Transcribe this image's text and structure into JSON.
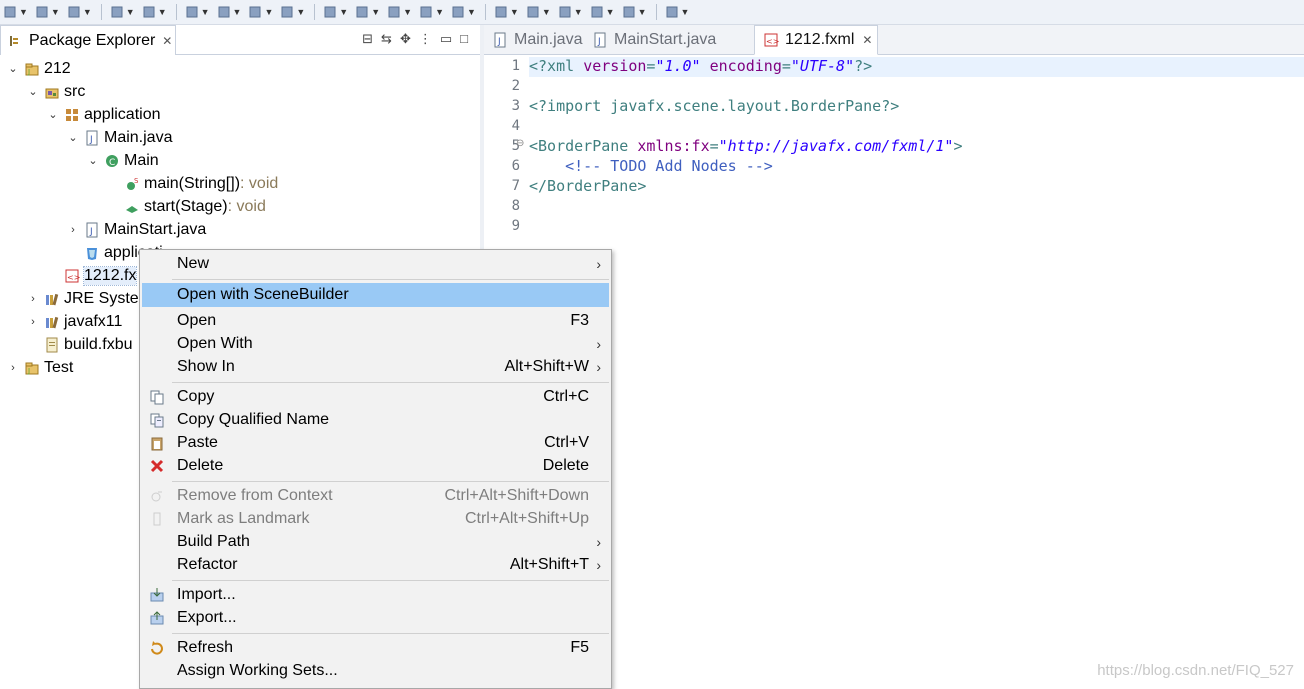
{
  "toolbar": {
    "icons": [
      "new-icon",
      "save-icon",
      "save-all-icon",
      "terminal-icon",
      "search-icon",
      "debug-icon",
      "run-icon",
      "run-extern-icon",
      "coverage-icon",
      "new-java-project-icon",
      "new-package-icon",
      "new-class-icon",
      "open-type-icon",
      "open-task-icon",
      "search-icon-2",
      "annotation-next-icon",
      "annotation-prev-icon",
      "back-icon",
      "forward-icon",
      "pin-editor-icon"
    ]
  },
  "explorer": {
    "tab_label": "Package Explorer",
    "tree": [
      {
        "label": "212",
        "depth": 0,
        "twisty": "open",
        "icon": "project-icon"
      },
      {
        "label": "src",
        "depth": 1,
        "twisty": "open",
        "icon": "source-folder-icon"
      },
      {
        "label": "application",
        "depth": 2,
        "twisty": "open",
        "icon": "package-icon"
      },
      {
        "label": "Main.java",
        "depth": 3,
        "twisty": "open",
        "icon": "java-file-icon"
      },
      {
        "label": "Main",
        "depth": 4,
        "twisty": "open",
        "icon": "class-icon"
      },
      {
        "label": "main(String[])",
        "suffix": " : void",
        "depth": 5,
        "twisty": "none",
        "icon": "static-method-icon"
      },
      {
        "label": "start(Stage)",
        "suffix": " : void",
        "depth": 5,
        "twisty": "none",
        "icon": "method-icon"
      },
      {
        "label": "MainStart.java",
        "depth": 3,
        "twisty": "closed",
        "icon": "java-file-icon"
      },
      {
        "label": "applicati",
        "depth": 3,
        "twisty": "none",
        "icon": "css-file-icon"
      },
      {
        "label": "1212.fx",
        "depth": 2,
        "twisty": "none",
        "icon": "fxml-file-icon",
        "selected": true
      },
      {
        "label": "JRE Syster",
        "depth": 1,
        "twisty": "closed",
        "icon": "library-icon"
      },
      {
        "label": "javafx11",
        "depth": 1,
        "twisty": "closed",
        "icon": "library-icon"
      },
      {
        "label": "build.fxbu",
        "depth": 1,
        "twisty": "none",
        "icon": "build-file-icon"
      },
      {
        "label": "Test",
        "depth": 0,
        "twisty": "closed",
        "icon": "project-icon"
      }
    ]
  },
  "editor": {
    "tabs": [
      {
        "label": "Main.java",
        "active": false
      },
      {
        "label": "MainStart.java",
        "active": false
      },
      {
        "label": "1212.fxml",
        "active": true
      }
    ],
    "lines": [
      {
        "n": "1",
        "segs": [
          [
            "tag",
            "<?xml "
          ],
          [
            "att",
            "version"
          ],
          [
            "tag",
            "="
          ],
          [
            "val",
            "\"1.0\""
          ],
          [
            "tag",
            " "
          ],
          [
            "att",
            "encoding"
          ],
          [
            "tag",
            "="
          ],
          [
            "val",
            "\"UTF-8\""
          ],
          [
            "tag",
            "?>"
          ]
        ]
      },
      {
        "n": "2",
        "segs": []
      },
      {
        "n": "3",
        "segs": [
          [
            "tag",
            "<?import javafx.scene.layout.BorderPane?>"
          ]
        ]
      },
      {
        "n": "4",
        "segs": []
      },
      {
        "n": "5",
        "segs": [
          [
            "tag",
            "<BorderPane "
          ],
          [
            "att",
            "xmlns:fx"
          ],
          [
            "tag",
            "="
          ],
          [
            "val",
            "\"http://javafx.com/fxml/1\""
          ],
          [
            "tag",
            ">"
          ]
        ]
      },
      {
        "n": "6",
        "segs": [
          [
            "com",
            "    <!-- TODO Add Nodes -->"
          ]
        ]
      },
      {
        "n": "7",
        "segs": [
          [
            "tag",
            "</BorderPane>"
          ]
        ]
      },
      {
        "n": "8",
        "segs": []
      },
      {
        "n": "9",
        "segs": []
      }
    ]
  },
  "context_menu": {
    "items": [
      {
        "label": "New",
        "shortcut": "",
        "submenu": true,
        "icon": ""
      },
      {
        "sep": true
      },
      {
        "label": "Open with SceneBuilder",
        "shortcut": "",
        "highlighted": true,
        "icon": ""
      },
      {
        "label": "Open",
        "shortcut": "F3",
        "icon": ""
      },
      {
        "label": "Open With",
        "shortcut": "",
        "submenu": true,
        "icon": ""
      },
      {
        "label": "Show In",
        "shortcut": "Alt+Shift+W",
        "submenu": true,
        "icon": ""
      },
      {
        "sep": true
      },
      {
        "label": "Copy",
        "shortcut": "Ctrl+C",
        "icon": "copy-icon"
      },
      {
        "label": "Copy Qualified Name",
        "shortcut": "",
        "icon": "copy-qualified-icon"
      },
      {
        "label": "Paste",
        "shortcut": "Ctrl+V",
        "icon": "paste-icon"
      },
      {
        "label": "Delete",
        "shortcut": "Delete",
        "icon": "delete-icon"
      },
      {
        "sep": true
      },
      {
        "label": "Remove from Context",
        "shortcut": "Ctrl+Alt+Shift+Down",
        "disabled": true,
        "icon": "remove-context-icon"
      },
      {
        "label": "Mark as Landmark",
        "shortcut": "Ctrl+Alt+Shift+Up",
        "disabled": true,
        "icon": "landmark-icon"
      },
      {
        "label": "Build Path",
        "shortcut": "",
        "submenu": true,
        "icon": ""
      },
      {
        "label": "Refactor",
        "shortcut": "Alt+Shift+T",
        "submenu": true,
        "icon": ""
      },
      {
        "sep": true
      },
      {
        "label": "Import...",
        "shortcut": "",
        "icon": "import-icon"
      },
      {
        "label": "Export...",
        "shortcut": "",
        "icon": "export-icon"
      },
      {
        "sep": true
      },
      {
        "label": "Refresh",
        "shortcut": "F5",
        "icon": "refresh-icon"
      },
      {
        "label": "Assign Working Sets...",
        "shortcut": "",
        "icon": ""
      }
    ]
  },
  "watermark": "https://blog.csdn.net/FIQ_527",
  "colors": {
    "menu_highlight": "#99c9f5",
    "xml_tag": "#3f7f7f",
    "xml_attribute": "#7f007f",
    "xml_value": "#2a00ff",
    "xml_comment": "#3f5fbf"
  }
}
